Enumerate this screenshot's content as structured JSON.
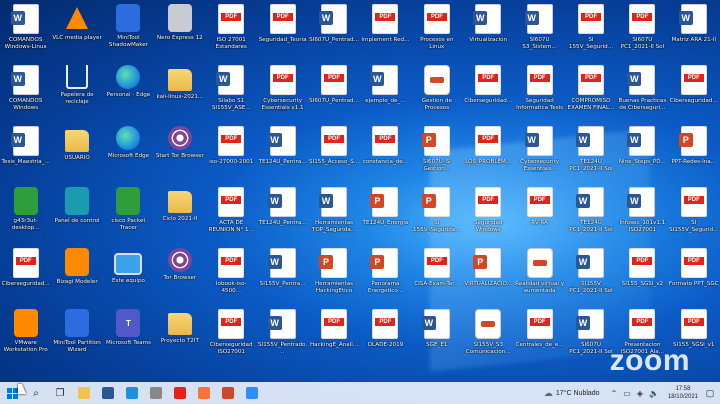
{
  "desktop": {
    "icons": [
      {
        "label": "COMANDOS Windows-Linux",
        "type": "word"
      },
      {
        "label": "COMANDOS Windows",
        "type": "word"
      },
      {
        "label": "Tesis_Maestria_...",
        "type": "word"
      },
      {
        "label": "g43r3ut-desktop...",
        "type": "app-green"
      },
      {
        "label": "Ciberseguridad...",
        "type": "pdf"
      },
      {
        "label": "VMware Workstation Pro",
        "type": "app-orange"
      },
      {
        "label": "VLC media player",
        "type": "vlc"
      },
      {
        "label": "Papelera de reciclaje",
        "type": "recycle"
      },
      {
        "label": "USUARIO",
        "type": "folder"
      },
      {
        "label": "Panel de control",
        "type": "app-teal"
      },
      {
        "label": "Bizagi Modeler",
        "type": "app-orange"
      },
      {
        "label": "MiniTool Partition Wizard",
        "type": "app"
      },
      {
        "label": "MiniTool ShadowMaker",
        "type": "app"
      },
      {
        "label": "Personal - Edge",
        "type": "edge"
      },
      {
        "label": "Microsoft Edge",
        "type": "edge"
      },
      {
        "label": "cisco Packet Tracer",
        "type": "app-green"
      },
      {
        "label": "Este equipo",
        "type": "monitor"
      },
      {
        "label": "Microsoft Teams",
        "type": "teams"
      },
      {
        "label": "Nero Express 12",
        "type": "app-gray"
      },
      {
        "label": "kali-linux-2021...",
        "type": "folder"
      },
      {
        "label": "Start Tor Browser",
        "type": "tor"
      },
      {
        "label": "Ciclo 2021-II",
        "type": "folder"
      },
      {
        "label": "Tor Browser",
        "type": "tor"
      },
      {
        "label": "Proyecto T2IT",
        "type": "folder"
      },
      {
        "label": "ISO 27001 Estandares",
        "type": "pdf"
      },
      {
        "label": "Silabo S1 SI155V_ASE...",
        "type": "word"
      },
      {
        "label": "iso-27000-2001",
        "type": "pdf"
      },
      {
        "label": "ACTA DE REUNION N° 1...",
        "type": "pdf"
      },
      {
        "label": "Iobook-iso-4500...",
        "type": "pdf"
      },
      {
        "label": "Ciberseguridad ISO27001",
        "type": "pdf"
      },
      {
        "label": "Seguridad_Teoria",
        "type": "pdf"
      },
      {
        "label": "Cybersecurity Essentials v1.1 SP",
        "type": "pdf"
      },
      {
        "label": "TE124U_Pentra...",
        "type": "word"
      },
      {
        "label": "TE124U_Pentra...",
        "type": "word"
      },
      {
        "label": "SI155V_Pentra...",
        "type": "word"
      },
      {
        "label": "SI155V_Pentrado...",
        "type": "word"
      },
      {
        "label": "SI607U_Pentrad...",
        "type": "word"
      },
      {
        "label": "SI607U_Pentrad...",
        "type": "pdf"
      },
      {
        "label": "SI155_Acceso_S...",
        "type": "pdf"
      },
      {
        "label": "Herramientas TOP_Segurida...",
        "type": "word"
      },
      {
        "label": "Herramientas HackingEtico",
        "type": "ppt"
      },
      {
        "label": "HackingE_Anali...",
        "type": "pdf"
      },
      {
        "label": "Implement Red...",
        "type": "pdf"
      },
      {
        "label": "ejemplo_de_...",
        "type": "word"
      },
      {
        "label": "constancia_de...",
        "type": "pdf"
      },
      {
        "label": "TE124U_Energia",
        "type": "ppt"
      },
      {
        "label": "Panorama Energetico...",
        "type": "ppt"
      },
      {
        "label": "OLADE-2019",
        "type": "pdf"
      },
      {
        "label": "Procesos en Linux",
        "type": "pdf"
      },
      {
        "label": "Gestion de Procesos",
        "type": "gesture"
      },
      {
        "label": "SI607U_SI Gestion...",
        "type": "ppt"
      },
      {
        "label": "SI 155V_Segurida...",
        "type": "ppt"
      },
      {
        "label": "CISA-Exam-Ter...",
        "type": "pdf"
      },
      {
        "label": "SGE_E1",
        "type": "word"
      },
      {
        "label": "Virtualización",
        "type": "word"
      },
      {
        "label": "Ciberseguridad...",
        "type": "pdf"
      },
      {
        "label": "LOS_PROBLEM...",
        "type": "pdf"
      },
      {
        "label": "Seguridad Windows",
        "type": "pdf"
      },
      {
        "label": "VIRTUALIZACIO...",
        "type": "ppt"
      },
      {
        "label": "SI155V_S3 Comunicacion...",
        "type": "gesture"
      },
      {
        "label": "SI607U S3_Sistem...",
        "type": "word"
      },
      {
        "label": "Seguridad Informatica Tesis",
        "type": "pdf"
      },
      {
        "label": "Cybersecurity Essentials - COR...",
        "type": "word"
      },
      {
        "label": "RV-RA",
        "type": "pdf"
      },
      {
        "label": "Realidad virtual y aumentada",
        "type": "gesture"
      },
      {
        "label": "Centrales_de_e...",
        "type": "pdf"
      },
      {
        "label": "SI 155V_Segurid...",
        "type": "pdf"
      },
      {
        "label": "COMPROMISO EXAMEN FINAL...",
        "type": "pdf"
      },
      {
        "label": "TE124U PC1_2021-II Sol",
        "type": "word"
      },
      {
        "label": "TE124U PC1_2021-II Sol",
        "type": "word"
      },
      {
        "label": "SI155V PC1_2021-II Sol",
        "type": "word"
      },
      {
        "label": "SI607U PC1_2021-II Sol",
        "type": "word"
      },
      {
        "label": "SI607U PC1_2021-II Sol",
        "type": "pdf"
      },
      {
        "label": "Buenas Practicas de Ciberseguri...",
        "type": "word"
      },
      {
        "label": "Nine_Steps_PD...",
        "type": "word"
      },
      {
        "label": "Infosec_101v1.1 ISO27001",
        "type": "word"
      },
      {
        "label": "SI155_SGSI_v2",
        "type": "pdf"
      },
      {
        "label": "Presentacion ISO27001 Ala...",
        "type": "pdf"
      },
      {
        "label": "Matriz ARA 21-II",
        "type": "word"
      },
      {
        "label": "Ciberseguridad...",
        "type": "pdf"
      },
      {
        "label": "PPT-Redes-Ina...",
        "type": "ppt"
      },
      {
        "label": "SI SI155V_Segurid...",
        "type": "pdf"
      },
      {
        "label": "Formato PPT_SGC",
        "type": "pdf"
      },
      {
        "label": "SI155_SGSI_v1",
        "type": "pdf"
      }
    ]
  },
  "zoom_watermark": "zoom",
  "taskbar": {
    "weather": "17°C  Nublado",
    "time": "17:58",
    "date": "18/10/2021",
    "apps": [
      {
        "name": "search-icon",
        "color": "#555"
      },
      {
        "name": "task-view-icon",
        "color": "#555"
      },
      {
        "name": "file-explorer-icon",
        "color": "#f2c14e"
      },
      {
        "name": "word-icon",
        "color": "#2b5797"
      },
      {
        "name": "edge-icon",
        "color": "#1f8fe0"
      },
      {
        "name": "store-icon",
        "color": "#888"
      },
      {
        "name": "office-icon",
        "color": "#e2231a"
      },
      {
        "name": "firefox-icon",
        "color": "#ff7139"
      },
      {
        "name": "powerpoint-icon",
        "color": "#d24726"
      },
      {
        "name": "zoom-icon",
        "color": "#2d8cff"
      }
    ]
  }
}
